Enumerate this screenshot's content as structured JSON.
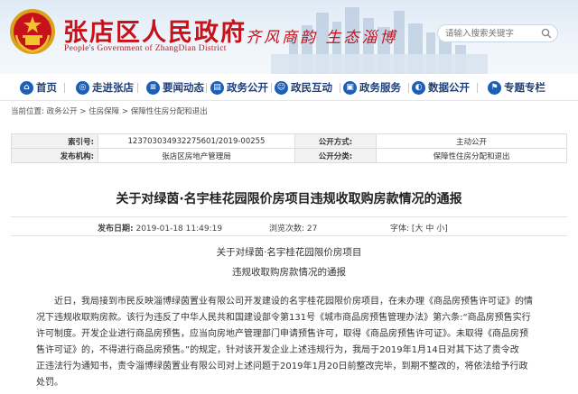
{
  "header": {
    "title": "张店区人民政府",
    "subtitle": "People's Government of ZhangDian District",
    "slogan": "齐风商韵 生态淄博",
    "search_placeholder": "请输入搜索关键字",
    "colors": {
      "brand_red": "#c8121a",
      "nav_blue": "#1f3f7a",
      "icon_blue": "#1d5fb6"
    }
  },
  "nav": [
    {
      "label": "首页",
      "icon": "home-icon"
    },
    {
      "label": "走进张店",
      "icon": "compass-icon"
    },
    {
      "label": "要闻动态",
      "icon": "news-icon"
    },
    {
      "label": "政务公开",
      "icon": "document-icon"
    },
    {
      "label": "政民互动",
      "icon": "people-icon"
    },
    {
      "label": "政务服务",
      "icon": "briefcase-icon"
    },
    {
      "label": "数据公开",
      "icon": "chart-icon"
    },
    {
      "label": "专题专栏",
      "icon": "flag-icon"
    }
  ],
  "breadcrumb": [
    "当前位置",
    "政务公开",
    "住房保障",
    "保障性住房分配和退出"
  ],
  "meta": {
    "index_label": "索引号:",
    "index_value": "123703034932275601/2019-00255",
    "scope_label": "公开方式:",
    "scope_value": "主动公开",
    "issuer_label": "发布机构:",
    "issuer_value": "张店区房地产管理局",
    "category_label": "公开分类:",
    "category_value": "保障性住房分配和退出"
  },
  "article": {
    "title": "关于对绿茵·名宇桂花园限价房项目违规收取购房款情况的通报",
    "published_label": "发布日期:",
    "published_value": "2019-01-18 11:49:19",
    "views_label": "浏览次数:",
    "views_value": "27",
    "font_size_label": "字体:",
    "font_size_options": [
      "大",
      "中",
      "小"
    ],
    "subtitle_lines": [
      "关于对绿茵·名宇桂花园限价房项目",
      "违规收取购房款情况的通报"
    ],
    "body_lines": [
      "近日，我局接到市民反映淄博绿茵置业有限公司开发建设的名宇桂花园限价房项目，在未办理《商品房预售许可证》的情",
      "况下违规收取购房款。该行为违反了中华人民共和国建设部令第131号《城市商品房预售管理办法》第六条:“商品房预售实行",
      "许可制度。开发企业进行商品房预售，应当向房地产管理部门申请预售许可，取得《商品房预售许可证》。未取得《商品房预",
      "售许可证》的，不得进行商品房预售。”的规定，针对该开发企业上述违规行为，我局于2019年1月14日对其下达了责令改",
      "正违法行为通知书，责令淄博绿茵置业有限公司对上述问题于2019年1月20日前整改完毕，到期不整改的，将依法给予行政",
      "处罚。"
    ]
  }
}
